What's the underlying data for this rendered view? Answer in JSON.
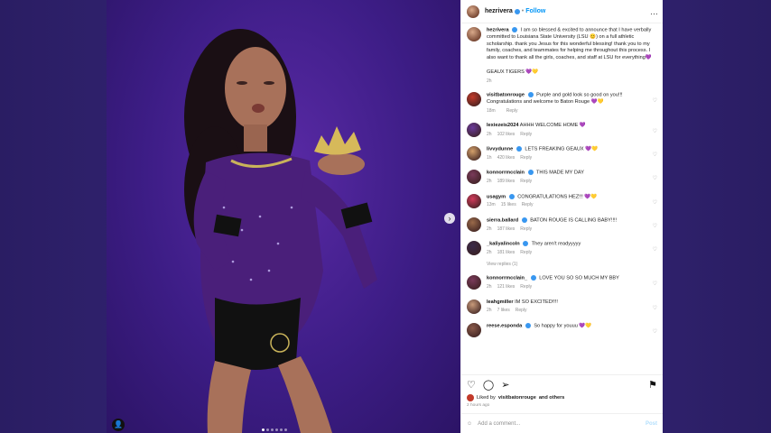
{
  "post": {
    "username": "hezrivera",
    "follow_label": "Follow",
    "more_icon": "…",
    "caption": "I am so blessed & excited to announce that I have verbally committed to Louisiana State University (LSU 😊) on a full athletic scholarship. thank you Jesus for this wonderful blessing! thank you to my family, coaches, and teammates for helping me throughout this process. I also want to thank all the girls, coaches, and staff at LSU for everything💜",
    "caption_tags": "GEAUX TIGERS 💜💛",
    "caption_time": "2h",
    "liked_by_prefix": "Liked by",
    "liked_by_user": "visitbatonrouge",
    "liked_by_suffix": "and others",
    "post_time": "2 hours ago",
    "add_comment_placeholder": "Add a comment...",
    "post_button": "Post",
    "emoji_icon": "☺"
  },
  "comments": [
    {
      "user": "visitbatonrouge",
      "verified": true,
      "text": "Purple and gold look so good on you!!! Congratulations and welcome to Baton Rouge 💜💛",
      "time": "18m",
      "likes": "",
      "reply": "Reply"
    },
    {
      "user": "lexiezeis2024",
      "verified": false,
      "text": "AHHH WELCOME HOME 💜",
      "time": "2h",
      "likes": "102 likes",
      "reply": "Reply"
    },
    {
      "user": "livvydunne",
      "verified": true,
      "text": "LETS FREAKING GEAUX 💜💛",
      "time": "1h",
      "likes": "420 likes",
      "reply": "Reply"
    },
    {
      "user": "konnorrmcclain",
      "verified": true,
      "text": "THIS MADE MY DAY",
      "time": "2h",
      "likes": "189 likes",
      "reply": "Reply"
    },
    {
      "user": "usagym",
      "verified": true,
      "text": "CONGRATULATIONS HEZ!!! 💜💛",
      "time": "13m",
      "likes": "15 likes",
      "reply": "Reply"
    },
    {
      "user": "sierra.ballard",
      "verified": true,
      "text": "BATON ROUGE IS CALLING BABY!!!!",
      "time": "2h",
      "likes": "187 likes",
      "reply": "Reply"
    },
    {
      "user": "_kaliyalincoln",
      "verified": true,
      "text": "They aren't readyyyyy",
      "time": "2h",
      "likes": "181 likes",
      "reply": "Reply",
      "view_replies": "View replies (1)"
    },
    {
      "user": "konnorrmcclain_",
      "verified": true,
      "text": "LOVE YOU SO SO MUCH MY BBY",
      "time": "2h",
      "likes": "121 likes",
      "reply": "Reply"
    },
    {
      "user": "leahgmiller",
      "verified": false,
      "text": "IM SO EXCITED!!!!",
      "time": "2h",
      "likes": "7 likes",
      "reply": "Reply"
    },
    {
      "user": "reese.esponda",
      "verified": true,
      "text": "So happy for youuu 💜💛",
      "time": "",
      "likes": "",
      "reply": ""
    }
  ],
  "icons": {
    "heart": "♡",
    "comment": "◯",
    "share": "➢",
    "save": "⚑",
    "next": "›",
    "tag_user": "👤"
  },
  "colors": {
    "background_purple": "#2d1f66",
    "link_blue": "#0095f6",
    "verified_blue": "#3897f0"
  }
}
